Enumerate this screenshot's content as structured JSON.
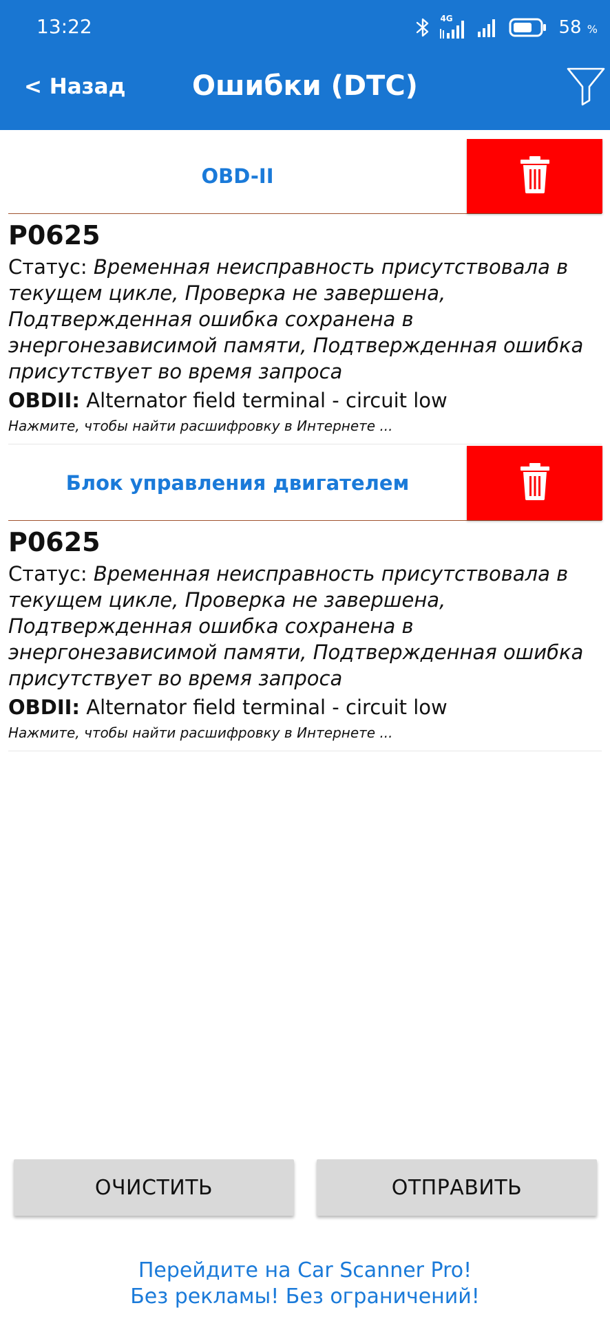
{
  "status_bar": {
    "time": "13:22",
    "network_label": "4G",
    "battery_percent": "58",
    "battery_unit": "%",
    "icons": [
      "bluetooth-icon",
      "signal-4g-icon",
      "signal-icon",
      "battery-icon"
    ]
  },
  "header": {
    "back_label": "< Назад",
    "title": "Ошибки (DTC)",
    "filter_icon": "filter-icon",
    "background_color": "#1976d2"
  },
  "sections": [
    {
      "title": "OBD-II",
      "delete_icon": "trash-icon",
      "dtcs": [
        {
          "code": "P0625",
          "status_label": "Статус:",
          "status_text": "Временная неисправность присутствовала в текущем цикле, Проверка не завершена, Подтвержденная ошибка сохранена в энергонезависимой памяти, Подтвержденная ошибка присутствует во время запроса",
          "desc_label": "OBDII:",
          "desc_text": "Alternator field terminal - circuit low",
          "hint": "Нажмите, чтобы найти расшифровку в Интернете ..."
        }
      ]
    },
    {
      "title": "Блок управления двигателем",
      "delete_icon": "trash-icon",
      "dtcs": [
        {
          "code": "P0625",
          "status_label": "Статус:",
          "status_text": "Временная неисправность присутствовала в текущем цикле, Проверка не завершена, Подтвержденная ошибка сохранена в энергонезависимой памяти, Подтвержденная ошибка присутствует во время запроса",
          "desc_label": "OBDII:",
          "desc_text": "Alternator field terminal - circuit low",
          "hint": "Нажмите, чтобы найти расшифровку в Интернете ..."
        }
      ]
    }
  ],
  "buttons": {
    "clear_label": "ОЧИСТИТЬ",
    "send_label": "ОТПРАВИТЬ"
  },
  "promo": {
    "line1": "Перейдите на Car Scanner Pro!",
    "line2": "Без рекламы! Без ограничений!"
  },
  "colors": {
    "accent": "#1a7ad9",
    "delete": "#ff0000",
    "button_gray": "#d9d9d9"
  }
}
